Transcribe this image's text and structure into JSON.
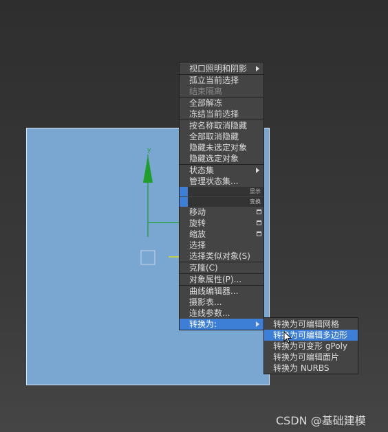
{
  "main_menu": {
    "items": [
      {
        "label": "视口照明和阴影",
        "submenu": true
      },
      {
        "label": "孤立当前选择"
      },
      {
        "label": "结束隔离",
        "disabled": true
      },
      {
        "label": "全部解冻"
      },
      {
        "label": "冻结当前选择"
      },
      {
        "label": "按名称取消隐藏"
      },
      {
        "label": "全部取消隐藏"
      },
      {
        "label": "隐藏未选定对象"
      },
      {
        "label": "隐藏选定对象"
      },
      {
        "label": "状态集",
        "submenu": true
      },
      {
        "label": "管理状态集..."
      },
      {
        "label": "移动"
      },
      {
        "label": "旋转"
      },
      {
        "label": "缩放"
      },
      {
        "label": "选择"
      },
      {
        "label": "选择类似对象(S)"
      },
      {
        "label": "克隆(C)"
      },
      {
        "label": "对象属性(P)..."
      },
      {
        "label": "曲线编辑器..."
      },
      {
        "label": "摄影表..."
      },
      {
        "label": "连线参数..."
      },
      {
        "label": "转换为:",
        "submenu": true
      }
    ],
    "quad_headers": [
      "显示",
      "变换"
    ]
  },
  "sub_menu": {
    "items": [
      {
        "label": "转换为可编辑网格"
      },
      {
        "label": "转换为可编辑多边形"
      },
      {
        "label": "转换为可变形 gPoly"
      },
      {
        "label": "转换为可编辑面片"
      },
      {
        "label": "转换为 NURBS"
      }
    ]
  },
  "gizmo": {
    "axis_label": "y"
  },
  "watermark": "CSDN @基础建模",
  "colors": {
    "menu_bg": "#444444",
    "highlight": "#3d7fd6",
    "plane": "#7aa6d2",
    "gizmo_green": "#1f9e2a",
    "gizmo_yellow": "#e6e600"
  }
}
